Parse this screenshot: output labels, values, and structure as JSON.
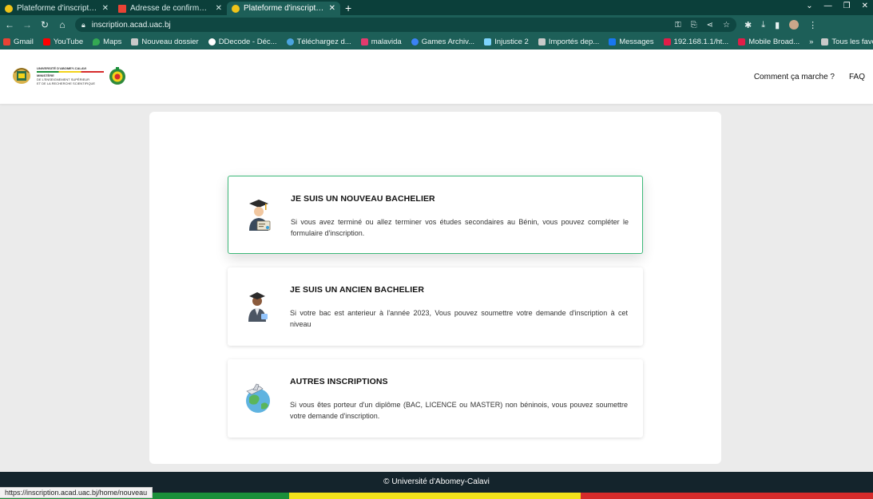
{
  "browser": {
    "tabs": [
      {
        "title": "Plateforme d'inscription",
        "active": false,
        "favicon_color": "#f0c419"
      },
      {
        "title": "Adresse de confirmation",
        "active": false,
        "favicon_color": "#ea4335"
      },
      {
        "title": "Plateforme d'inscription",
        "active": true,
        "favicon_color": "#f0c419"
      }
    ],
    "new_tab": "+",
    "url": "inscription.acad.uac.bj",
    "bookmarks": [
      {
        "label": "Gmail",
        "color": "#ea4335"
      },
      {
        "label": "YouTube",
        "color": "#ff0000"
      },
      {
        "label": "Maps",
        "color": "#34a853"
      },
      {
        "label": "Nouveau dossier",
        "color": "#c9c9c9"
      },
      {
        "label": "DDecode - Déc...",
        "color": "#ffffff"
      },
      {
        "label": "Téléchargez d...",
        "color": "#4aa3df"
      },
      {
        "label": "malavida",
        "color": "#e33b6e"
      },
      {
        "label": "Games Archiv...",
        "color": "#3b82f6"
      },
      {
        "label": "Injustice 2",
        "color": "#7dd3fc"
      },
      {
        "label": "Importés dep...",
        "color": "#c9c9c9"
      },
      {
        "label": "Messages",
        "color": "#1877f2"
      },
      {
        "label": "192.168.1.1/ht...",
        "color": "#e11d48"
      },
      {
        "label": "Mobile Broad...",
        "color": "#e11d48"
      }
    ],
    "bookmarks_more": "»",
    "all_bookmarks": "Tous les favoris",
    "status_url": "https://inscription.acad.uac.bj/home/nouveau"
  },
  "header": {
    "logo_lines": [
      "UNIVERSITÉ D'ABOMEY-CALAVI",
      "MINISTÈRE",
      "DE L'ENSEIGNEMENT SUPÉRIEUR",
      "ET DE LA RECHERCHE SCIENTIFIQUE"
    ],
    "nav": [
      "Comment ça marche ?",
      "FAQ"
    ]
  },
  "options": [
    {
      "title": "JE SUIS UN NOUVEAU BACHELIER",
      "description": "Si vous avez terminé ou allez terminer vos études secondaires au Bénin, vous pouvez compléter le formulaire d'inscription.",
      "icon": "graduate-diploma-icon",
      "active": true
    },
    {
      "title": "JE SUIS UN ANCIEN BACHELIER",
      "description": "Si votre bac est anterieur à l'année 2023, Vous pouvez soumettre votre demande d'inscription à cet niveau",
      "icon": "graduate-person-icon",
      "active": false
    },
    {
      "title": "AUTRES INSCRIPTIONS",
      "description": "Si vous êtes porteur d'un diplôme (BAC, LICENCE ou MASTER) non béninois, vous pouvez soumettre votre demande d'inscription.",
      "icon": "globe-plane-icon",
      "active": false
    }
  ],
  "footer": {
    "copyright": "© Université d'Abomey-Calavi"
  },
  "colors": {
    "browser_dark": "#0b3f3a",
    "browser_mid": "#1d5f58",
    "accent_green": "#3cb878",
    "footer_bg": "#14242c",
    "flag_green": "#1a8f3a",
    "flag_yellow": "#f2e21a",
    "flag_red": "#d62b2b"
  }
}
